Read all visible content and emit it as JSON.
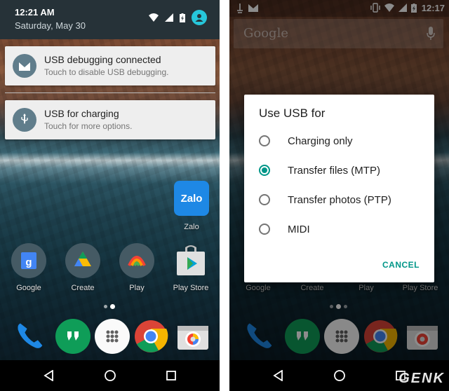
{
  "left": {
    "shade": {
      "time": "12:21 AM",
      "date": "Saturday, May 30"
    },
    "notifications": [
      {
        "title": "USB debugging connected",
        "subtitle": "Touch to disable USB debugging.",
        "icon": "android-debug-icon"
      },
      {
        "title": "USB for charging",
        "subtitle": "Touch for more options.",
        "icon": "usb-icon"
      }
    ],
    "apps": {
      "zalo": {
        "icon_text": "Zalo",
        "label": "Zalo"
      },
      "row": [
        {
          "label": "Google",
          "icon": "google-folder-icon"
        },
        {
          "label": "Create",
          "icon": "create-folder-icon"
        },
        {
          "label": "Play",
          "icon": "play-folder-icon"
        },
        {
          "label": "Play Store",
          "icon": "play-store-icon"
        }
      ]
    },
    "dock": [
      "phone-icon",
      "hangouts-icon",
      "app-drawer-icon",
      "chrome-icon",
      "camera-icon"
    ]
  },
  "right": {
    "status_time": "12:17",
    "search_word": "Google",
    "dialog": {
      "title": "Use USB for",
      "options": [
        {
          "label": "Charging only",
          "checked": false
        },
        {
          "label": "Transfer files (MTP)",
          "checked": true
        },
        {
          "label": "Transfer photos (PTP)",
          "checked": false
        },
        {
          "label": "MIDI",
          "checked": false
        }
      ],
      "cancel": "CANCEL"
    },
    "row_labels": [
      "Google",
      "Create",
      "Play",
      "Play Store"
    ]
  },
  "watermark": "GENK",
  "colors": {
    "accent": "#009688",
    "shade": "#263238",
    "notif_icon_bg": "#607d8b",
    "avatar": "#26c6da"
  }
}
